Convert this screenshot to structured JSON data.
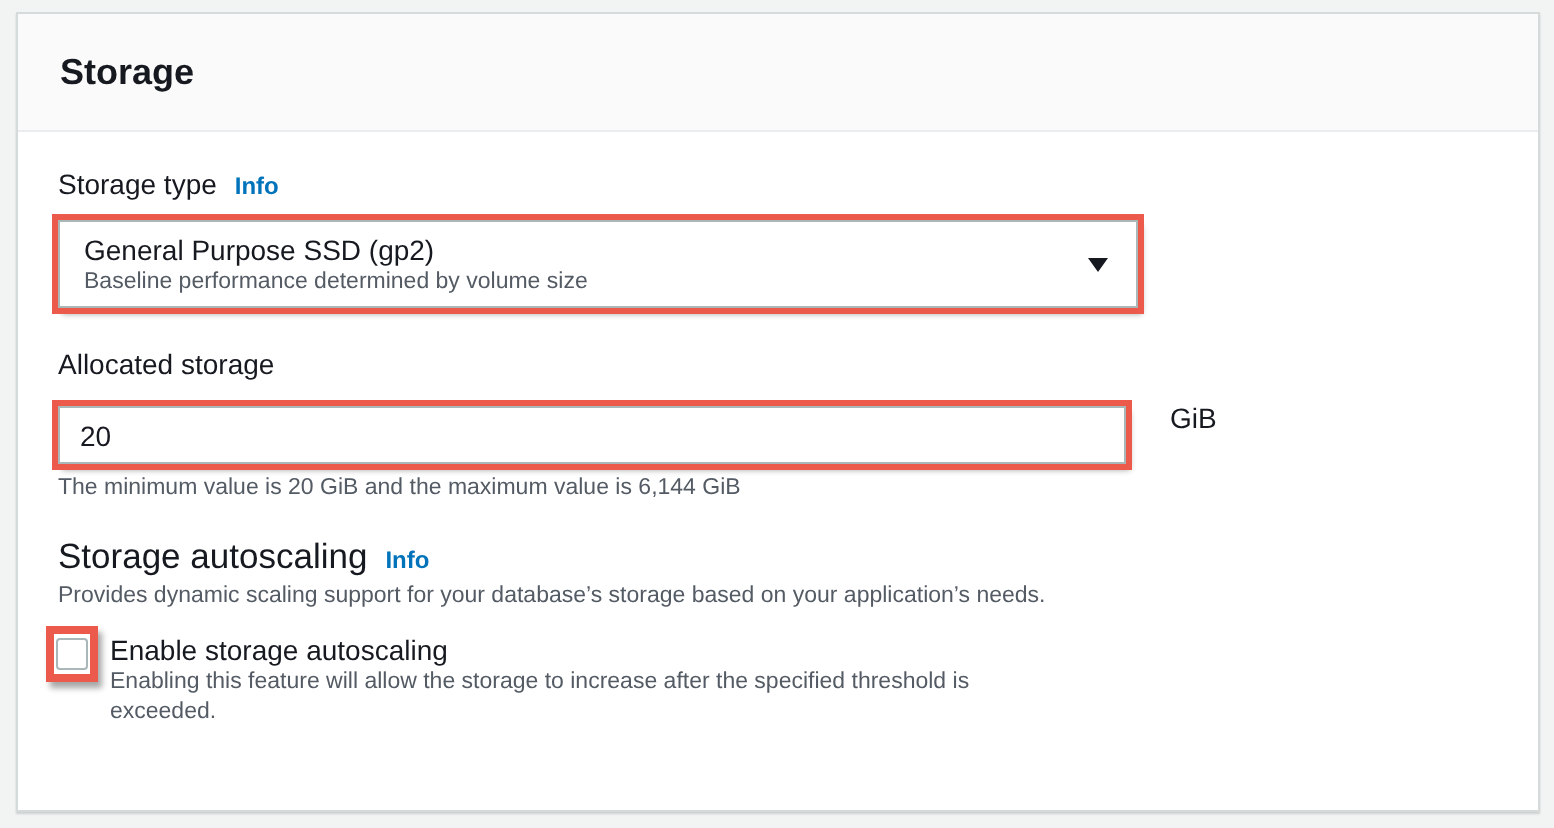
{
  "panel": {
    "title": "Storage"
  },
  "storage_type": {
    "label": "Storage type",
    "info": "Info",
    "value": "General Purpose SSD (gp2)",
    "description": "Baseline performance determined by volume size",
    "highlighted": true
  },
  "allocated_storage": {
    "label": "Allocated storage",
    "value": "20",
    "unit": "GiB",
    "hint": "The minimum value is 20 GiB and the maximum value is 6,144 GiB",
    "highlighted": true
  },
  "autoscaling": {
    "heading": "Storage autoscaling",
    "info": "Info",
    "description": "Provides dynamic scaling support for your database’s storage based on your application’s needs.",
    "checkbox": {
      "label": "Enable storage autoscaling",
      "description": "Enabling this feature will allow the storage to increase after the specified threshold is exceeded.",
      "checked": false,
      "highlighted": true
    }
  }
}
